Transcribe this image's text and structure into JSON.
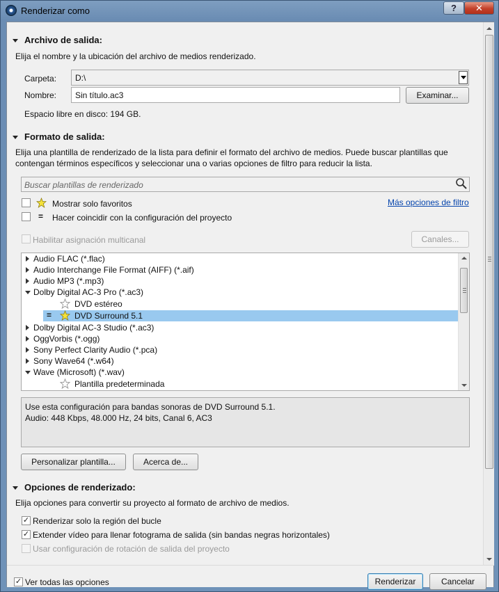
{
  "window": {
    "title": "Renderizar como",
    "help_label": "?",
    "close_label": "✕"
  },
  "output_file": {
    "header": "Archivo de salida:",
    "description": "Elija el nombre y la ubicación del archivo de medios renderizado.",
    "folder_label": "Carpeta:",
    "folder_value": "D:\\",
    "name_label": "Nombre:",
    "name_value": "Sin título.ac3",
    "browse_label": "Examinar...",
    "free_space": "Espacio libre en disco: 194 GB."
  },
  "output_format": {
    "header": "Formato de salida:",
    "description_line1": "Elija una plantilla de renderizado de la lista para definir el formato del archivo de medios. Puede buscar plantillas que",
    "description_line2": "contengan términos específicos y seleccionar una o varias opciones de filtro para reducir la lista.",
    "search_placeholder": "Buscar plantillas de renderizado",
    "favorites_label": "Mostrar solo favoritos",
    "more_filters_link": "Más opciones de filtro",
    "match_project_label": "Hacer coincidir con la configuración del proyecto",
    "multichannel_label": "Habilitar asignación multicanal",
    "channels_button": "Canales...",
    "eq_glyph": "=",
    "tree_items": [
      {
        "label": "Audio FLAC (*.flac)",
        "level": 0,
        "expanded": false
      },
      {
        "label": "Audio Interchange File Format (AIFF) (*.aif)",
        "level": 0,
        "expanded": false
      },
      {
        "label": "Audio MP3 (*.mp3)",
        "level": 0,
        "expanded": false
      },
      {
        "label": "Dolby Digital AC-3 Pro (*.ac3)",
        "level": 0,
        "expanded": true
      },
      {
        "label": "DVD estéreo",
        "level": 1,
        "favorite": false
      },
      {
        "label": "DVD Surround 5.1",
        "level": 1,
        "favorite": true,
        "selected": true,
        "match": true
      },
      {
        "label": "Dolby Digital AC-3 Studio (*.ac3)",
        "level": 0,
        "expanded": false
      },
      {
        "label": "OggVorbis (*.ogg)",
        "level": 0,
        "expanded": false
      },
      {
        "label": "Sony Perfect Clarity Audio (*.pca)",
        "level": 0,
        "expanded": false
      },
      {
        "label": "Sony Wave64 (*.w64)",
        "level": 0,
        "expanded": false
      },
      {
        "label": "Wave (Microsoft) (*.wav)",
        "level": 0,
        "expanded": true
      },
      {
        "label": "Plantilla predeterminada",
        "level": 1,
        "favorite": false
      }
    ],
    "template_description_line1": "Use esta configuración para bandas sonoras de DVD Surround 5.1.",
    "template_description_line2": "Audio: 448 Kbps, 48.000 Hz, 24 bits, Canal 6, AC3",
    "customize_button": "Personalizar plantilla...",
    "about_button": "Acerca de..."
  },
  "render_options": {
    "header": "Opciones de renderizado:",
    "description": "Elija opciones para convertir su proyecto al formato de archivo de medios.",
    "opt_loop_region": "Renderizar solo la región del bucle",
    "opt_stretch_video": "Extender vídeo para llenar fotograma de salida (sin bandas negras horizontales)",
    "opt_rotation": "Usar configuración de rotación de salida del proyecto"
  },
  "footer": {
    "show_all_label": "Ver todas las opciones",
    "render_button": "Renderizar",
    "cancel_button": "Cancelar"
  },
  "colors": {
    "selection": "#99c9ef",
    "link": "#0645ad",
    "title_bar": "#7e9ec0"
  }
}
